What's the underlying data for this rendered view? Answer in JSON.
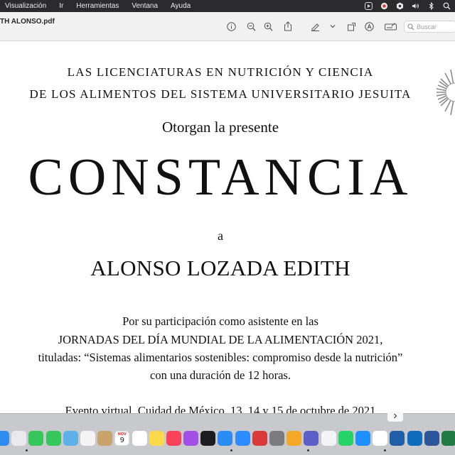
{
  "menubar": {
    "items": [
      "Visualización",
      "Ir",
      "Herramientas",
      "Ventana",
      "Ayuda"
    ],
    "status_icons": [
      "media-icon",
      "cast-icon",
      "shield-icon",
      "volume-icon",
      "bluetooth-icon",
      "search-icon"
    ]
  },
  "toolbar": {
    "doc_title": "TH ALONSO.pdf",
    "search_placeholder": "Buscar"
  },
  "document": {
    "institution_line1": "LAS LICENCIATURAS EN NUTRICIÓN Y CIENCIA",
    "institution_line2": "DE LOS ALIMENTOS DEL SISTEMA UNIVERSITARIO JESUITA",
    "grant_text": "Otorgan la presente",
    "heading": "CONSTANCIA",
    "to_word": "a",
    "recipient": "ALONSO LOZADA EDITH",
    "body_line1": "Por su participación como asistente en las",
    "body_line2": "JORNADAS DEL DÍA MUNDIAL DE LA ALIMENTACIÓN 2021,",
    "body_line3": "tituladas: “Sistemas alimentarios sostenibles: compromiso desde la nutrición”",
    "body_line4": "con una duración de 12 horas.",
    "event_line": "Evento virtual, Cuidad de México, 13, 14 y 15 de octubre de 2021"
  },
  "dock": {
    "calendar_month": "NOV",
    "calendar_day": "9",
    "apps": [
      {
        "name": "finder",
        "color": "#2f8cf0",
        "glyph": ""
      },
      {
        "name": "launchpad",
        "color": "#e9e9ee",
        "glyph": ""
      },
      {
        "name": "messages",
        "color": "#35c759",
        "glyph": ""
      },
      {
        "name": "facetime",
        "color": "#34c759",
        "glyph": ""
      },
      {
        "name": "maps",
        "color": "#5db1e8",
        "glyph": ""
      },
      {
        "name": "photos",
        "color": "#f4f4f4",
        "glyph": ""
      },
      {
        "name": "contacts",
        "color": "#c8a46c",
        "glyph": ""
      },
      {
        "name": "calendar",
        "color": "#ffffff",
        "glyph": ""
      },
      {
        "name": "reminders",
        "color": "#ffffff",
        "glyph": ""
      },
      {
        "name": "notes",
        "color": "#fcd94a",
        "glyph": ""
      },
      {
        "name": "music",
        "color": "#fa4358",
        "glyph": ""
      },
      {
        "name": "podcasts",
        "color": "#a24fe6",
        "glyph": ""
      },
      {
        "name": "apple-tv",
        "color": "#1c1c1e",
        "glyph": ""
      },
      {
        "name": "app-store",
        "color": "#2a8cf5",
        "glyph": ""
      },
      {
        "name": "zoom",
        "color": "#2d8cff",
        "glyph": ""
      },
      {
        "name": "zotero",
        "color": "#d93a3a",
        "glyph": ""
      },
      {
        "name": "disk-utility",
        "color": "#7b7b80",
        "glyph": ""
      },
      {
        "name": "office-folder",
        "color": "#f3a826",
        "glyph": ""
      },
      {
        "name": "teams",
        "color": "#5b5fc7",
        "glyph": ""
      },
      {
        "name": "preview",
        "color": "#f4f4f6",
        "glyph": ""
      },
      {
        "name": "whatsapp",
        "color": "#25d366",
        "glyph": ""
      },
      {
        "name": "safari",
        "color": "#1e90ff",
        "glyph": ""
      },
      {
        "name": "chrome",
        "color": "#ffffff",
        "glyph": ""
      },
      {
        "name": "vscode",
        "color": "#1f5fa8",
        "glyph": ""
      },
      {
        "name": "outlook",
        "color": "#0f6cbd",
        "glyph": ""
      },
      {
        "name": "word",
        "color": "#2b579a",
        "glyph": ""
      },
      {
        "name": "excel",
        "color": "#1f7a44",
        "glyph": ""
      }
    ]
  }
}
